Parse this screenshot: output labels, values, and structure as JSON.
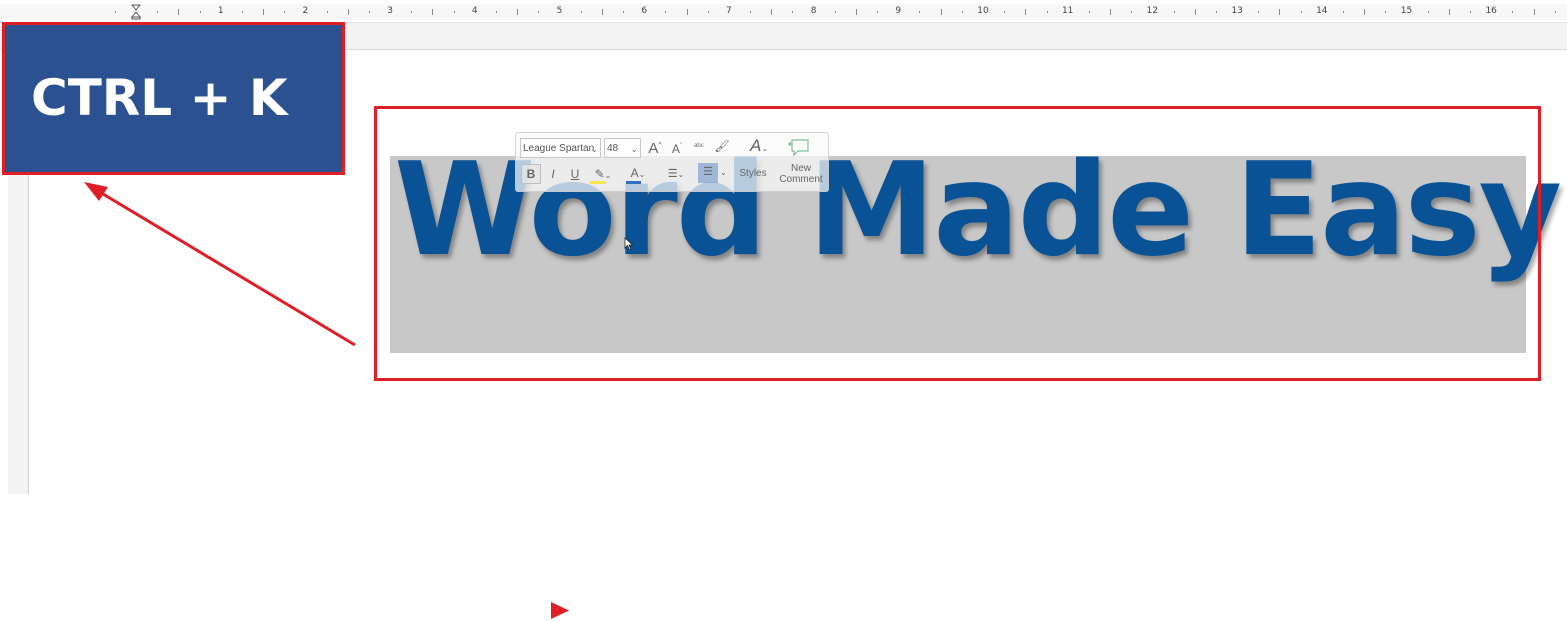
{
  "ruler": {
    "numbers": [
      "1",
      "2",
      "3",
      "4",
      "5",
      "6",
      "7",
      "8",
      "9",
      "10",
      "11",
      "12",
      "13",
      "14",
      "15",
      "16"
    ]
  },
  "hotkey": {
    "label": "CTRL + K"
  },
  "document": {
    "headline": "Word Made Easy"
  },
  "mini_toolbar": {
    "font_name": "League Spartan",
    "font_size": "48",
    "grow_font": "A",
    "shrink_font": "A",
    "bold": "B",
    "italic": "I",
    "underline": "U",
    "font_color": "A",
    "styles_label": "Styles",
    "new_comment_label_line1": "New",
    "new_comment_label_line2": "Comment"
  },
  "colors": {
    "hotkey_bg": "#2c5190",
    "accent_red": "#e01e26",
    "headline_blue": "#0a5296",
    "selection_gray": "#c8c8c8"
  }
}
